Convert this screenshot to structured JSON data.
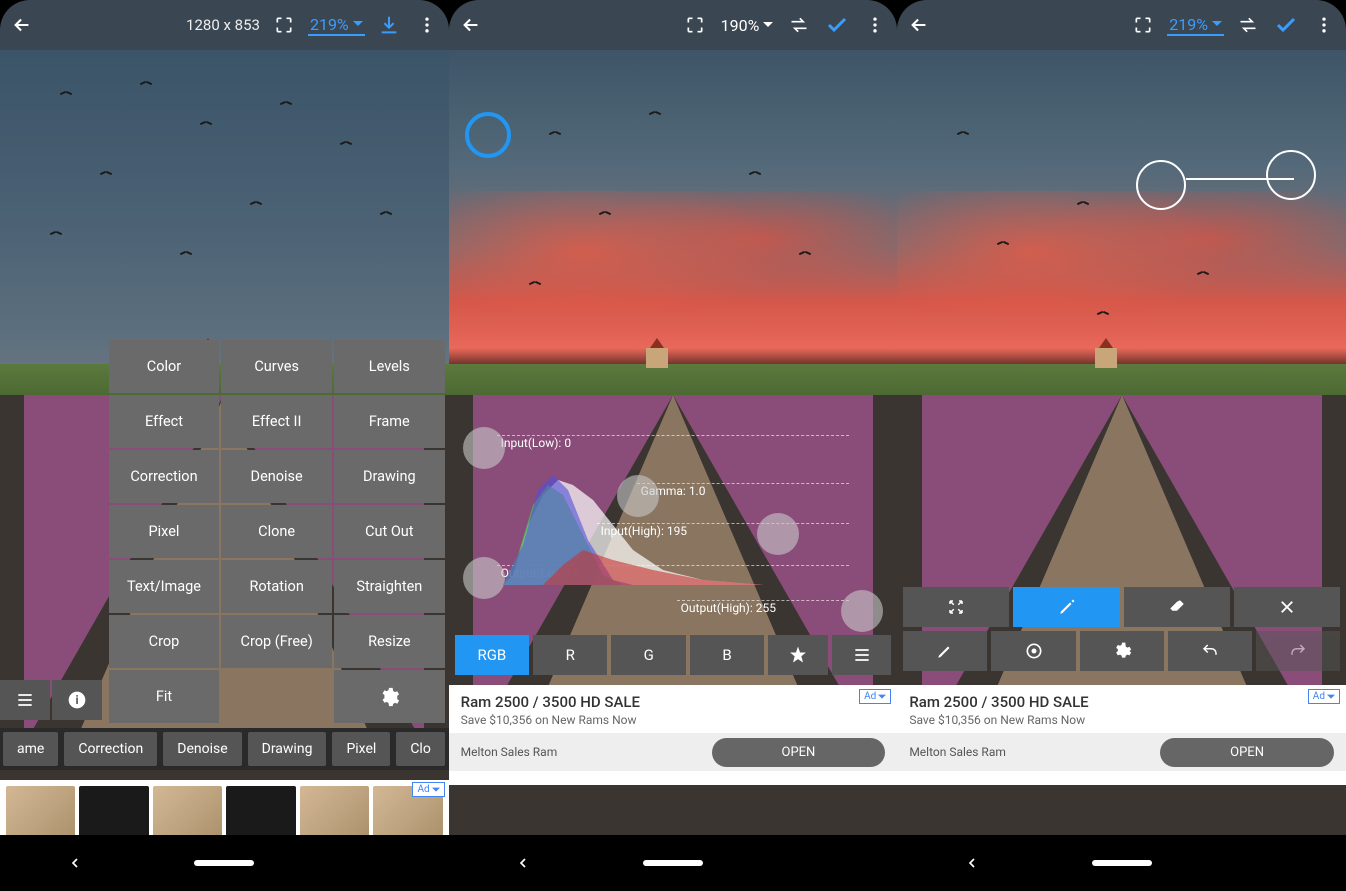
{
  "screen1": {
    "dimensions": "1280 x 853",
    "zoom": "219%",
    "menu": [
      "Color",
      "Curves",
      "Levels",
      "Effect",
      "Effect II",
      "Frame",
      "Correction",
      "Denoise",
      "Drawing",
      "Pixel",
      "Clone",
      "Cut Out",
      "Text/Image",
      "Rotation",
      "Straighten",
      "Crop",
      "Crop (Free)",
      "Resize",
      "Fit"
    ],
    "tabs": [
      "ame",
      "Correction",
      "Denoise",
      "Drawing",
      "Pixel",
      "Clo"
    ],
    "ad_badge": "Ad"
  },
  "screen2": {
    "zoom": "190%",
    "levels": {
      "input_low": "Input(Low): 0",
      "gamma": "Gamma: 1.0",
      "input_high": "Input(High): 195",
      "output_low": "Output(Low): 0",
      "output_high": "Output(High): 255"
    },
    "channels": [
      "RGB",
      "R",
      "G",
      "B"
    ],
    "ad": {
      "title": "Ram 2500 / 3500 HD SALE",
      "subtitle": "Save $10,356 on New Rams Now",
      "brand": "Melton Sales Ram",
      "cta": "OPEN",
      "badge": "Ad"
    }
  },
  "screen3": {
    "zoom": "219%",
    "ad": {
      "title": "Ram 2500 / 3500 HD SALE",
      "subtitle": "Save $10,356 on New Rams Now",
      "brand": "Melton Sales Ram",
      "cta": "OPEN",
      "badge": "Ad"
    }
  }
}
